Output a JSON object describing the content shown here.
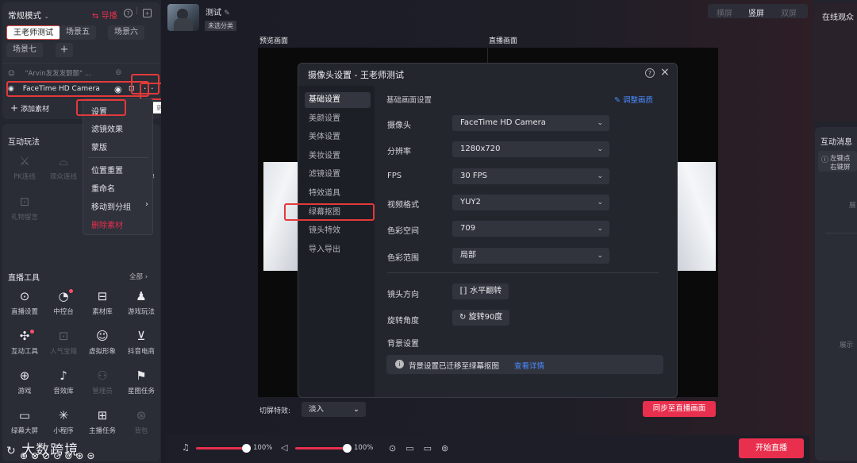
{
  "left": {
    "mode_label": "常规模式",
    "director_label": "导播",
    "scenes": [
      "王老师测试",
      "场景五",
      "场景六",
      "场景七"
    ],
    "sources": [
      {
        "label": "\"Arvin发发发颤颤\" ..."
      },
      {
        "label": "FaceTime HD Camera"
      }
    ],
    "add_source_label": "添加素材",
    "tooltip_text": "更多",
    "interactive_title": "互动玩法",
    "interactive_items": [
      {
        "label": "PK连线",
        "icon": "pk-icon",
        "dim": true
      },
      {
        "label": "观众连线",
        "icon": "audience-link-icon",
        "dim": true
      },
      {
        "label": "宠粉红包",
        "icon": "red-packet-icon",
        "dim": false
      },
      {
        "label": "礼物菜单",
        "icon": "gift-menu-icon",
        "dim": false
      },
      {
        "label": "礼物留言",
        "icon": "gift-message-icon",
        "dim": true
      }
    ],
    "tools_title": "直播工具",
    "tools_all": "全部",
    "tools": [
      {
        "label": "直播设置",
        "icon": "live-settings-icon",
        "dim": false
      },
      {
        "label": "中控台",
        "icon": "control-center-icon",
        "dim": false
      },
      {
        "label": "素材库",
        "icon": "material-library-icon",
        "dim": false
      },
      {
        "label": "游戏玩法",
        "icon": "game-play-icon",
        "dim": false
      },
      {
        "label": "互动工具",
        "icon": "interactive-tools-icon",
        "dim": false
      },
      {
        "label": "人气宝箱",
        "icon": "treasure-box-icon",
        "dim": true
      },
      {
        "label": "虚拟形象",
        "icon": "avatar-icon",
        "dim": false
      },
      {
        "label": "抖音电商",
        "icon": "shopping-cart-icon",
        "dim": false
      },
      {
        "label": "游戏",
        "icon": "gamepad-icon",
        "dim": false
      },
      {
        "label": "音效库",
        "icon": "sound-effects-icon",
        "dim": false
      },
      {
        "label": "管理员",
        "icon": "admin-icon",
        "dim": true
      },
      {
        "label": "星图任务",
        "icon": "star-task-icon",
        "dim": false
      },
      {
        "label": "绿幕大屏",
        "icon": "green-screen-icon",
        "dim": false
      },
      {
        "label": "小程序",
        "icon": "mini-program-icon",
        "dim": false
      },
      {
        "label": "主播任务",
        "icon": "host-task-icon",
        "dim": false
      },
      {
        "label": "背包",
        "icon": "backpack-icon",
        "dim": true
      }
    ],
    "watermark": "大数跨境"
  },
  "context_menu": [
    "设置",
    "滤镜效果",
    "蒙版",
    "位置重置",
    "重命名",
    "移动到分组",
    "删除素材"
  ],
  "center": {
    "user_name": "测试",
    "category_tag": "未选分类",
    "orient": [
      "横屏",
      "竖屏",
      "双屏"
    ],
    "preview_label": "预览画面",
    "live_label": "直播画面",
    "transition_label": "切屏特效:",
    "transition_value": "淡入",
    "sync_button": "同步至直播画面",
    "vol1": "100%",
    "vol2": "100%",
    "start_button": "开始直播"
  },
  "dialog": {
    "title": "摄像头设置 - 王老师测试",
    "sidebar": [
      "基础设置",
      "美颜设置",
      "美体设置",
      "美妆设置",
      "滤镜设置",
      "特效道具",
      "绿幕抠图",
      "镜头特效",
      "导入导出"
    ],
    "section_title": "基础画面设置",
    "adjust_link": "调整画质",
    "fields": [
      {
        "label": "摄像头",
        "value": "FaceTime HD Camera"
      },
      {
        "label": "分辨率",
        "value": "1280x720"
      },
      {
        "label": "FPS",
        "value": "30 FPS"
      },
      {
        "label": "视频格式",
        "value": "YUY2"
      },
      {
        "label": "色彩空间",
        "value": "709"
      },
      {
        "label": "色彩范围",
        "value": "局部"
      }
    ],
    "lens_label": "镜头方向",
    "lens_button": "水平翻转",
    "rotate_label": "旋转角度",
    "rotate_button": "旋转90度",
    "bg_label": "背景设置",
    "bg_notice": "背景设置已迁移至绿幕抠图",
    "bg_link": "查看详情"
  },
  "right": {
    "online_label": "在线观众",
    "messages_label": "互动消息",
    "hint_line1": "左键点",
    "hint_line2": "右键屏",
    "side_text1": "展",
    "side_text2": "展示"
  },
  "colors": {
    "accent": "#e8304e",
    "link": "#4a8cff",
    "highlight": "#e23a3a"
  }
}
